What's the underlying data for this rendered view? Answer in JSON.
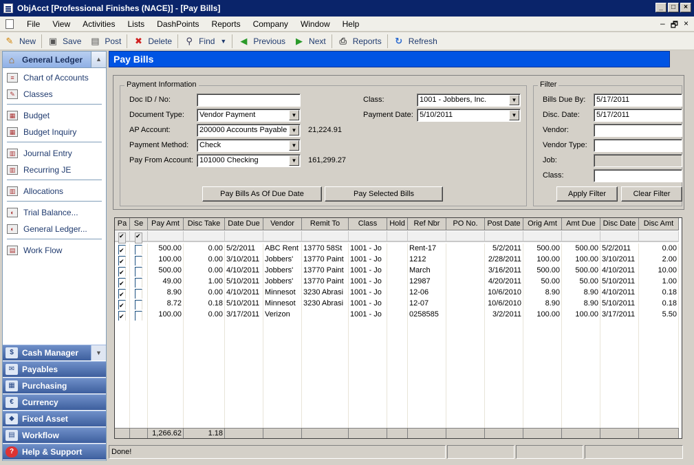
{
  "window": {
    "title": "ObjAcct [Professional Finishes (NACE)] - [Pay Bills]",
    "controls": [
      "_",
      "□",
      "×"
    ],
    "mdi_controls": [
      "–",
      "🗗",
      "×"
    ]
  },
  "menu": [
    {
      "label": "File"
    },
    {
      "label": "View"
    },
    {
      "label": "Activities"
    },
    {
      "label": "Lists"
    },
    {
      "label": "DashPoints"
    },
    {
      "label": "Reports"
    },
    {
      "label": "Company"
    },
    {
      "label": "Window"
    },
    {
      "label": "Help"
    }
  ],
  "toolbar": [
    {
      "label": "New",
      "icon": "new-icon"
    },
    {
      "label": "Save",
      "icon": "save-icon"
    },
    {
      "label": "Post",
      "icon": "post-icon"
    },
    {
      "label": "Delete",
      "icon": "delete-icon"
    },
    {
      "label": "Find",
      "icon": "find-icon"
    },
    {
      "label": "Previous",
      "icon": "arrow-left-icon"
    },
    {
      "label": "Next",
      "icon": "arrow-right-icon"
    },
    {
      "label": "Reports",
      "icon": "printer-icon"
    },
    {
      "label": "Refresh",
      "icon": "refresh-icon"
    }
  ],
  "sidebar": {
    "header": "General Ledger",
    "items": [
      "Chart of Accounts",
      "Classes",
      "Budget",
      "Budget Inquiry",
      "Journal Entry",
      "Recurring JE",
      "Allocations",
      "Trial Balance...",
      "General Ledger...",
      "Work Flow"
    ],
    "modules": [
      "Cash Manager",
      "Payables",
      "Purchasing",
      "Currency",
      "Fixed Asset",
      "Workflow",
      "Help & Support"
    ]
  },
  "page_title": "Pay Bills",
  "payment_info": {
    "legend": "Payment Information",
    "doc_id_label": "Doc ID / No:",
    "doc_id_value": "",
    "doc_type_label": "Document Type:",
    "doc_type_value": "Vendor Payment",
    "ap_account_label": "AP Account:",
    "ap_account_value": "200000 Accounts Payable",
    "ap_balance": "21,224.91",
    "payment_method_label": "Payment Method:",
    "payment_method_value": "Check",
    "pay_from_label": "Pay From Account:",
    "pay_from_value": "101000 Checking",
    "pay_from_balance": "161,299.27",
    "class_label": "Class:",
    "class_value": "1001 - Jobbers, Inc.",
    "payment_date_label": "Payment Date:",
    "payment_date_value": "5/10/2011",
    "btn_pay_due": "Pay Bills As Of Due Date",
    "btn_pay_selected": "Pay Selected Bills"
  },
  "filter": {
    "legend": "Filter",
    "bills_due_label": "Bills Due By:",
    "bills_due_value": "5/17/2011",
    "disc_date_label": "Disc. Date:",
    "disc_date_value": "5/17/2011",
    "vendor_label": "Vendor:",
    "vendor_type_label": "Vendor Type:",
    "job_label": "Job:",
    "class_label": "Class:",
    "btn_apply": "Apply Filter",
    "btn_clear": "Clear Filter"
  },
  "grid": {
    "columns": [
      "Pa",
      "Se",
      "Pay Amt",
      "Disc Take",
      "Date Due",
      "Vendor",
      "Remit To",
      "Class",
      "Hold",
      "Ref Nbr",
      "PO No.",
      "Post Date",
      "Orig Amt",
      "Amt Due",
      "Disc Date",
      "Disc Amt"
    ],
    "rows": [
      {
        "pay": true,
        "sel": false,
        "pay_amt": "500.00",
        "disc_take": "0.00",
        "date_due": "5/2/2011",
        "vendor": "ABC Rent",
        "remit_to": "13770 58St",
        "class": "1001 - Jo",
        "hold": "",
        "ref": "Rent-17",
        "po": "",
        "post_date": "5/2/2011",
        "orig_amt": "500.00",
        "amt_due": "500.00",
        "disc_date": "5/2/2011",
        "disc_amt": "0.00"
      },
      {
        "pay": true,
        "sel": false,
        "pay_amt": "100.00",
        "disc_take": "0.00",
        "date_due": "3/10/2011",
        "vendor": "Jobbers'",
        "remit_to": "13770 Paint",
        "class": "1001 - Jo",
        "hold": "",
        "ref": "1212",
        "po": "",
        "post_date": "2/28/2011",
        "orig_amt": "100.00",
        "amt_due": "100.00",
        "disc_date": "3/10/2011",
        "disc_amt": "2.00"
      },
      {
        "pay": true,
        "sel": false,
        "pay_amt": "500.00",
        "disc_take": "0.00",
        "date_due": "4/10/2011",
        "vendor": "Jobbers'",
        "remit_to": "13770 Paint",
        "class": "1001 - Jo",
        "hold": "",
        "ref": "March",
        "po": "",
        "post_date": "3/16/2011",
        "orig_amt": "500.00",
        "amt_due": "500.00",
        "disc_date": "4/10/2011",
        "disc_amt": "10.00"
      },
      {
        "pay": true,
        "sel": false,
        "pay_amt": "49.00",
        "disc_take": "1.00",
        "date_due": "5/10/2011",
        "vendor": "Jobbers'",
        "remit_to": "13770 Paint",
        "class": "1001 - Jo",
        "hold": "",
        "ref": "12987",
        "po": "",
        "post_date": "4/20/2011",
        "orig_amt": "50.00",
        "amt_due": "50.00",
        "disc_date": "5/10/2011",
        "disc_amt": "1.00"
      },
      {
        "pay": true,
        "sel": false,
        "pay_amt": "8.90",
        "disc_take": "0.00",
        "date_due": "4/10/2011",
        "vendor": "Minnesot",
        "remit_to": "3230 Abrasi",
        "class": "1001 - Jo",
        "hold": "",
        "ref": "12-06",
        "po": "",
        "post_date": "10/6/2010",
        "orig_amt": "8.90",
        "amt_due": "8.90",
        "disc_date": "4/10/2011",
        "disc_amt": "0.18"
      },
      {
        "pay": true,
        "sel": false,
        "pay_amt": "8.72",
        "disc_take": "0.18",
        "date_due": "5/10/2011",
        "vendor": "Minnesot",
        "remit_to": "3230 Abrasi",
        "class": "1001 - Jo",
        "hold": "",
        "ref": "12-07",
        "po": "",
        "post_date": "10/6/2010",
        "orig_amt": "8.90",
        "amt_due": "8.90",
        "disc_date": "5/10/2011",
        "disc_amt": "0.18"
      },
      {
        "pay": true,
        "sel": false,
        "pay_amt": "100.00",
        "disc_take": "0.00",
        "date_due": "3/17/2011",
        "vendor": "Verizon",
        "remit_to": "",
        "class": "1001 - Jo",
        "hold": "",
        "ref": "0258585",
        "po": "",
        "post_date": "3/2/2011",
        "orig_amt": "100.00",
        "amt_due": "100.00",
        "disc_date": "3/17/2011",
        "disc_amt": "5.50"
      }
    ],
    "total_pay_amt": "1,266.62",
    "total_disc_take": "1.18"
  },
  "status": "Done!"
}
